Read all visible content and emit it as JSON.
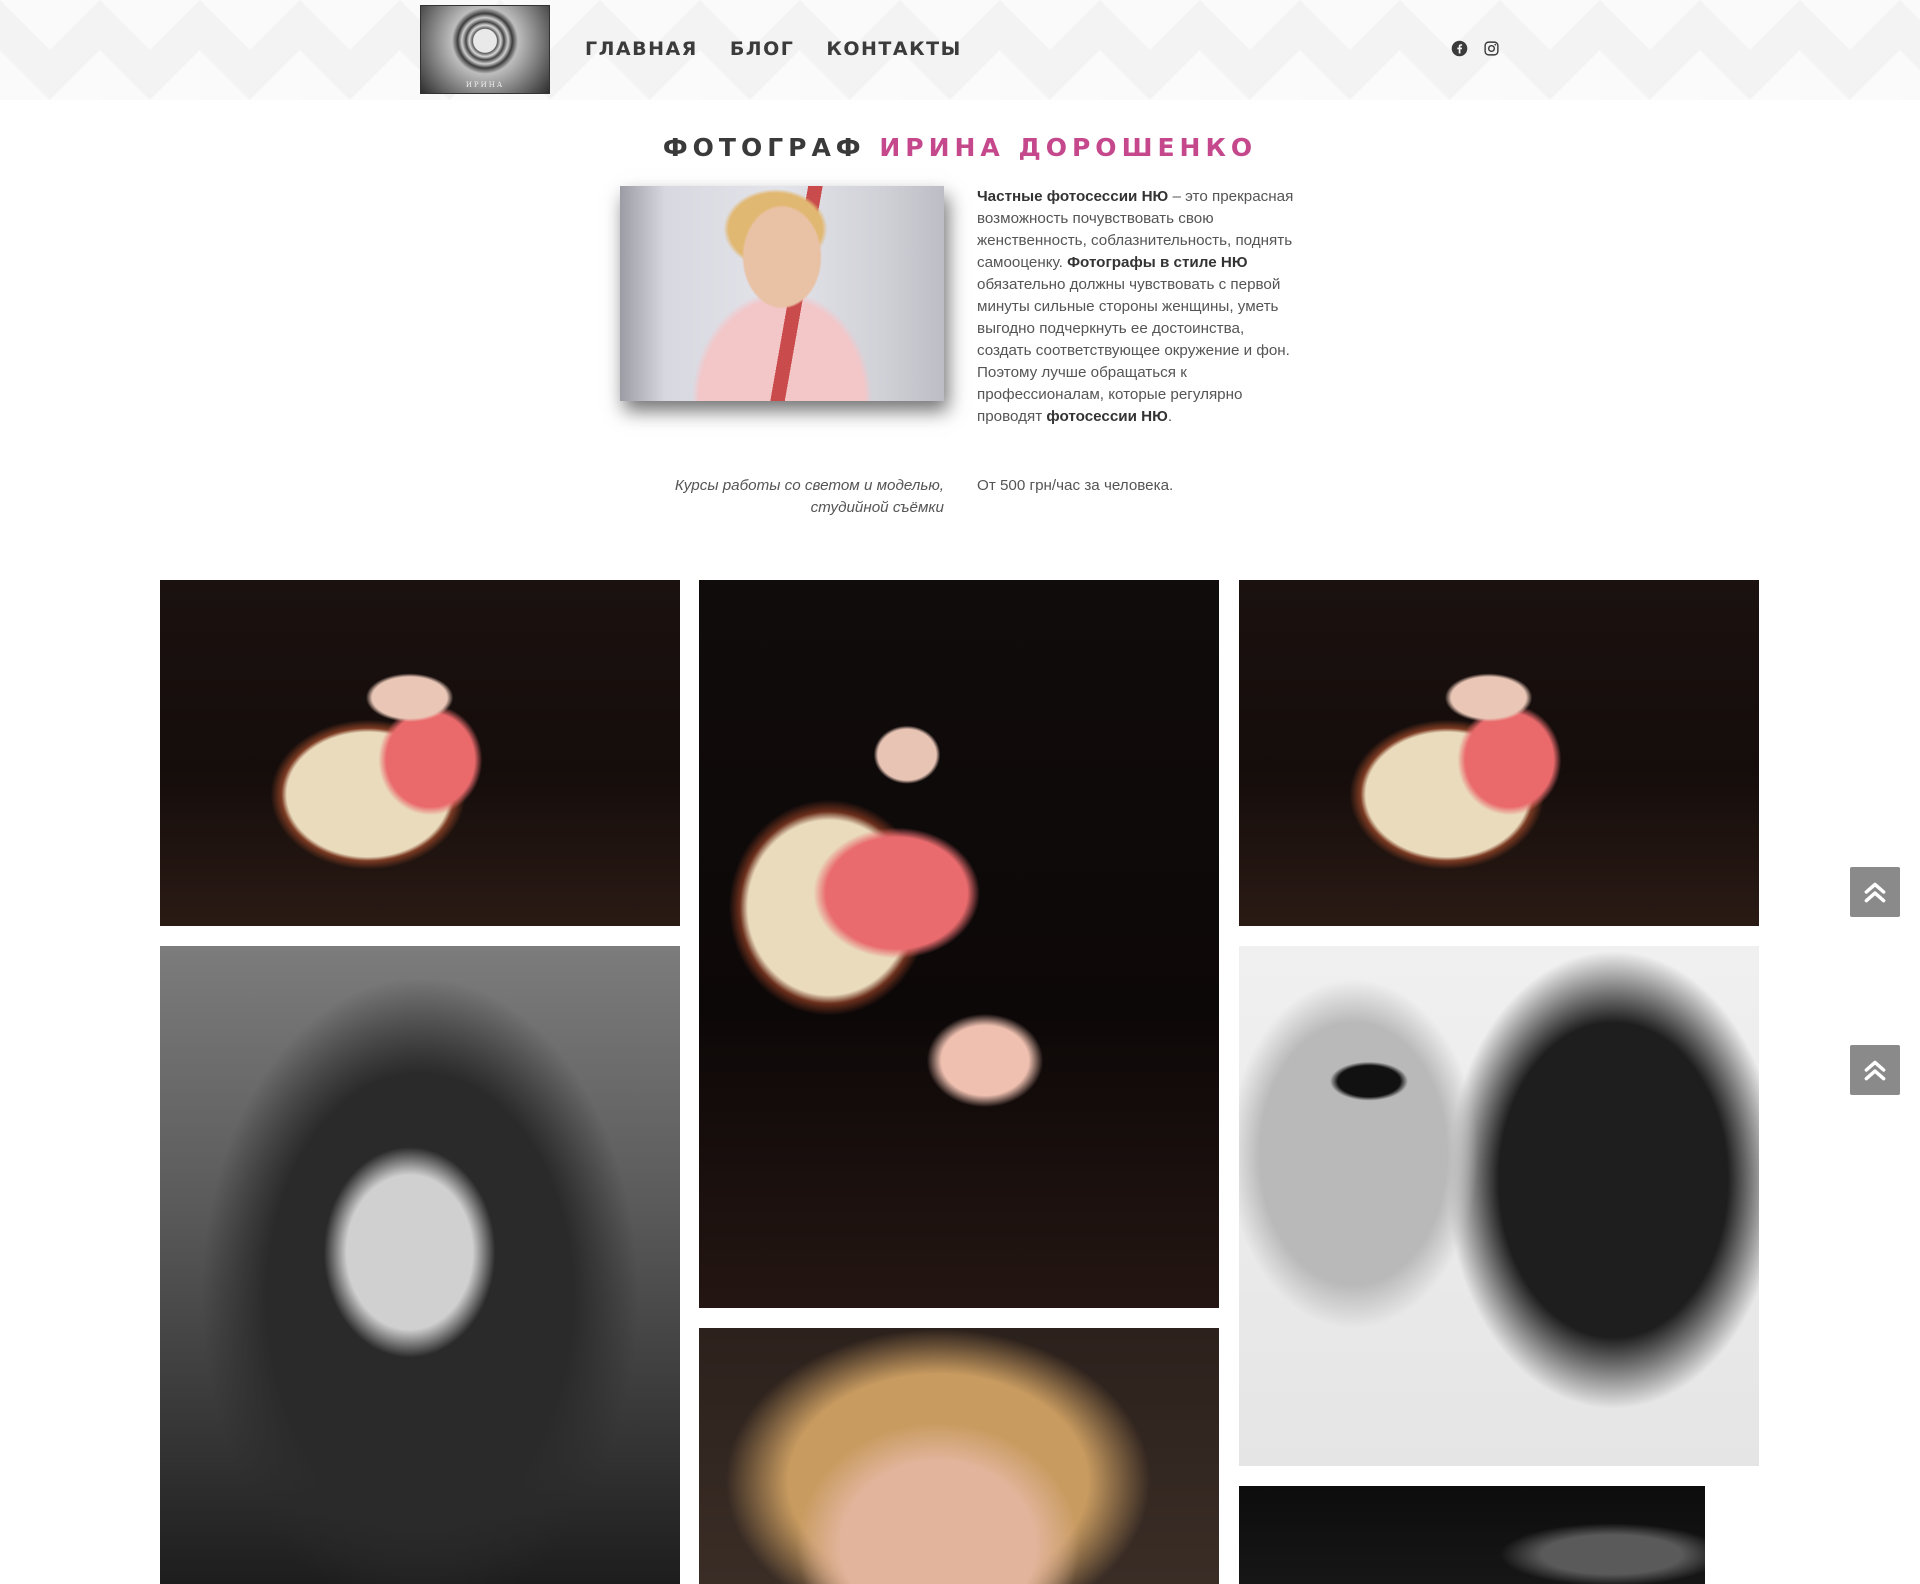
{
  "header": {
    "logo_text": "ИРИНА",
    "nav": [
      "ГЛАВНАЯ",
      "БЛОГ",
      "КОНТАКТЫ"
    ],
    "social_icons": [
      "facebook-icon",
      "instagram-icon"
    ]
  },
  "intro": {
    "title_part1": "ФОТОГРАФ",
    "title_part2": "ИРИНА ДОРОШЕНКО",
    "accent_color": "#c5488c",
    "text_p1": "Частные фотосессии НЮ",
    "text_p2": " – это прекрасная возможность почувствовать свою женственность, соблазнительность, поднять самооценку. ",
    "text_p3": "Фотографы в стиле НЮ",
    "text_p4": " обязательно должны чувствовать с первой минуты сильные стороны женщины, уметь выгодно подчеркнуть ее достоинства, создать соответствующее окружение и фон. Поэтому лучше обращаться к профессионалам, которые регулярно проводят ",
    "text_p5": "фотосессии НЮ",
    "text_p6": ".",
    "course_label": "Курсы работы со светом и моделью, студийной съёмки",
    "course_price": "От 500 грн/час за человека."
  },
  "scroll_buttons": [
    "double-chevron-up-icon",
    "double-chevron-up-icon"
  ]
}
